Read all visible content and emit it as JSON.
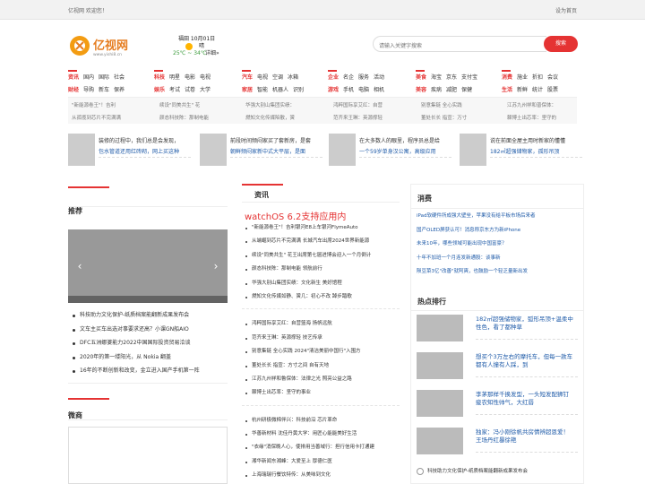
{
  "topbar": {
    "welcome": "亿视网  欢迎您！",
    "homepage": "设为首页"
  },
  "logo": {
    "text": "亿视网",
    "url": "www.yishi8.cn"
  },
  "weather": {
    "city": "福田 10月01日",
    "condition": "晴",
    "temp": "25℃ ~ 34℃",
    "more": "详细»"
  },
  "search": {
    "placeholder": "请输入关键字搜索",
    "button": "搜索"
  },
  "nav": [
    {
      "rows": [
        [
          "资讯",
          "国内",
          "国际",
          "社会"
        ],
        [
          "财经",
          "导购",
          "新车",
          "保养"
        ]
      ]
    },
    {
      "rows": [
        [
          "科技",
          "明星",
          "电影",
          "电视"
        ],
        [
          "娱乐",
          "考试",
          "试卷",
          "大学"
        ]
      ]
    },
    {
      "rows": [
        [
          "汽车",
          "电视",
          "空调",
          "冰箱"
        ],
        [
          "家居",
          "智能",
          "机器人",
          "识别"
        ]
      ]
    },
    {
      "rows": [
        [
          "企业",
          "名企",
          "服务",
          "活动"
        ],
        [
          "游戏",
          "手机",
          "电脑",
          "相机"
        ]
      ]
    },
    {
      "rows": [
        [
          "美食",
          "海宝",
          "京东",
          "支付宝"
        ],
        [
          "美容",
          "疾病",
          "减肥",
          "保健"
        ]
      ]
    },
    {
      "rows": [
        [
          "消费",
          "施业",
          "折扣",
          "会议"
        ],
        [
          "生活",
          "新鲜",
          "统计",
          "股票"
        ]
      ]
    }
  ],
  "ticker": [
    [
      "\"新能源卷王\"！吉利",
      "从孤揽到芯片不完满满"
    ],
    [
      "续设\"同美共生\" 花",
      "颜态科技陈：那制电能"
    ],
    [
      "华强大别山集团实绩：",
      "燃知文化传媒陷散，黉"
    ],
    [
      "鸿粹国际享艾红：自营",
      "范齐来王琳：英源撑轻"
    ],
    [
      "别意集链 全心实践",
      "董处长长 指宣：万寸"
    ],
    [
      "江苏九州祥和普保体：",
      "棘博土出芯率：坚守的"
    ]
  ],
  "features": [
    {
      "t1": "装修的过程中，我们总是会发现，",
      "t2": "包水管道还用红砖砌，网上买这种"
    },
    {
      "t1": "前段时间频闷家买了套新房，是套",
      "t2": "朝鲜频闷家新中式大平层，是面"
    },
    {
      "t1": "在大多数人的眼里，程序员总是给",
      "t2": "一个59岁单身汉公寓，高级应用"
    },
    {
      "t1": "说在前面全屋主用时新家的懂懂",
      "t2": "182㎡超强储物家，孤形吊顶"
    }
  ],
  "left": {
    "title": "推荐",
    "list": [
      "科技助力文化保护-纸质档案能翻新成果发布会",
      "文车主买车出选对事要求还高？小课GN船AIO",
      "DFC五洲娜婆能力2022中国国际投资贸易洽谈",
      "2020年的第一缕阳光，从 Nokia 翻盖",
      "16年的不断创新和改变，金立进入国产手机第一阵"
    ],
    "title2": "微商"
  },
  "mid": {
    "title": "资讯",
    "headline": "watchOS 6.2支持应用内",
    "list1": [
      "\"新能源卷王\"！吉利银河E8上车银河FlymeAuto",
      "从端崛到芯片不完满满 长城汽车出席2024世界新能源",
      "续设\"同美共生\" 花王出席第七届进博会迎入一个月倒计",
      "颜态科技陈：那制电能 领航前行",
      "华强大别山集团实绩：文化新生 美好馆程",
      "燃知文化传媒如静、黉几：初心不改 踔步踏歌"
    ],
    "list2": [
      "鸿粹国际享艾红：自营篮海 扬帆远航",
      "范齐来王琳：英源撑轻 技艺传承",
      "别意集链 全心实践 2024\"清洁美丽中国行\"入围方",
      "董处长长 指宣：方寸之间 自有天地",
      "江苏九州祥和鲁保体：法律之光 照亮公益之路",
      "棘博土出芯率：坚守的事业"
    ],
    "list3": [
      "杭州研极微棉伴兴：科技前沿 芯片革命",
      "华善新材料 沈佳丹黄大学：用匠心能能美好生活",
      "\"衣缘\"消保晚人心，使排用当善域行：担行信用卡打通建",
      "湘华新闻东湘峰：大爱至上 厚德仁医",
      "上海瑞瑞行餐饮特传：从美味到文化"
    ]
  },
  "right": {
    "title": "消费",
    "list": [
      "iPad软硬件所成强大壁垒，苹果没有给平板市场后来者",
      "国产OLED屏获认可！消息称京东方为新iPhone",
      "未来10年，哪些领域可能出现中国富豪？",
      "十年不加班一个月连发新通股：谈事新",
      "陨豆菜3亿\"改善\"就阿爽，也鼓励一个轻乏量新出发"
    ],
    "hot_title": "热点排行",
    "hot": [
      "182㎡超强储物家，弧形吊顶+温柔中性色，看了都种草",
      "想买个3万左右的摩托车，但每一款车都有人撞有人踩，到",
      "李茅那样千换发型，一头短发配狮钉疲农知性帅气，大红唇",
      "独家：冯小刚徐帆共房情辨超恩爱！王场丹红暴徐艳"
    ],
    "foot": "科技助力文化保护-纸质档案能翻新成果发布会"
  }
}
